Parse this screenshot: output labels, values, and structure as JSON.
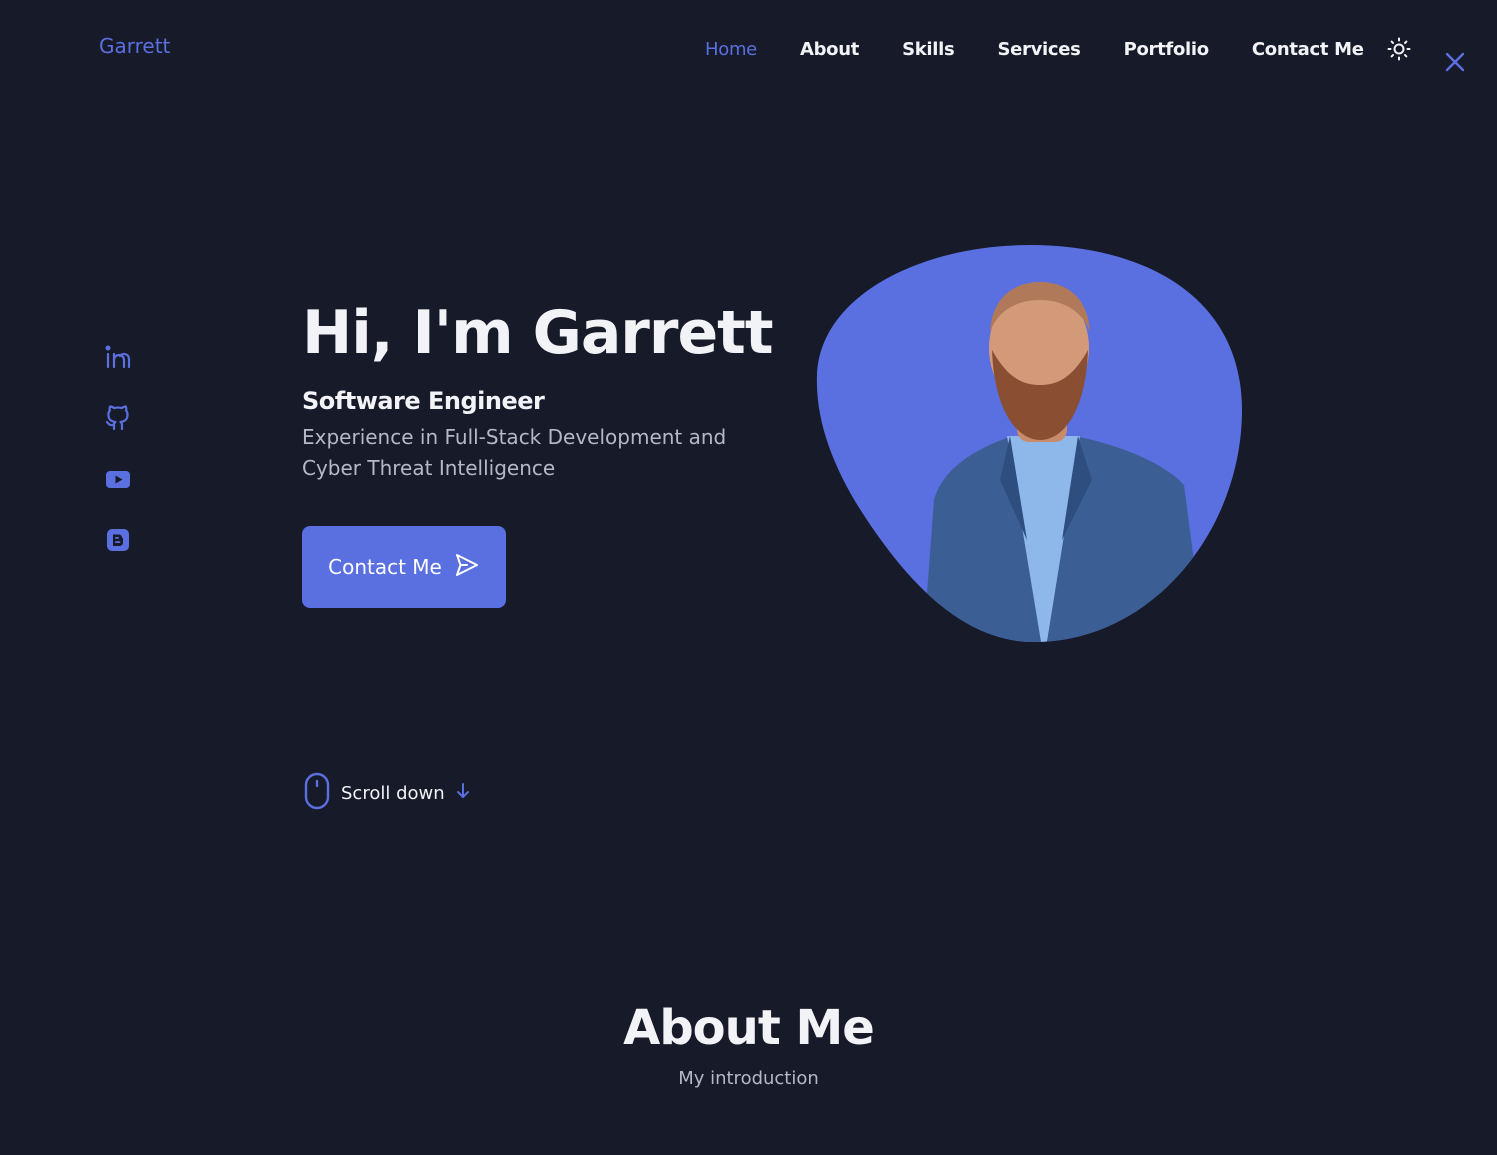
{
  "brand": {
    "logo": "Garrett",
    "accent_color": "#5a6fe0",
    "background_color": "#171a29"
  },
  "nav": {
    "items": [
      {
        "label": "Home",
        "active": true
      },
      {
        "label": "About",
        "active": false
      },
      {
        "label": "Skills",
        "active": false
      },
      {
        "label": "Services",
        "active": false
      },
      {
        "label": "Portfolio",
        "active": false
      },
      {
        "label": "Contact Me",
        "active": false
      }
    ],
    "theme_toggle_icon": "sun-icon",
    "close_icon": "close-icon"
  },
  "socials": [
    {
      "icon": "linkedin-icon"
    },
    {
      "icon": "github-icon"
    },
    {
      "icon": "youtube-icon"
    },
    {
      "icon": "blogger-icon"
    }
  ],
  "hero": {
    "title": "Hi, I'm Garrett",
    "subtitle": "Software Engineer",
    "description": "Experience in Full-Stack Development and Cyber Threat Intelligence",
    "button_label": "Contact Me",
    "button_icon": "send-icon",
    "portrait_icon": "portrait-image"
  },
  "scroll": {
    "label": "Scroll down",
    "mouse_icon": "mouse-icon",
    "arrow_icon": "arrow-down-icon"
  },
  "about": {
    "title": "About Me",
    "subtitle": "My introduction"
  }
}
